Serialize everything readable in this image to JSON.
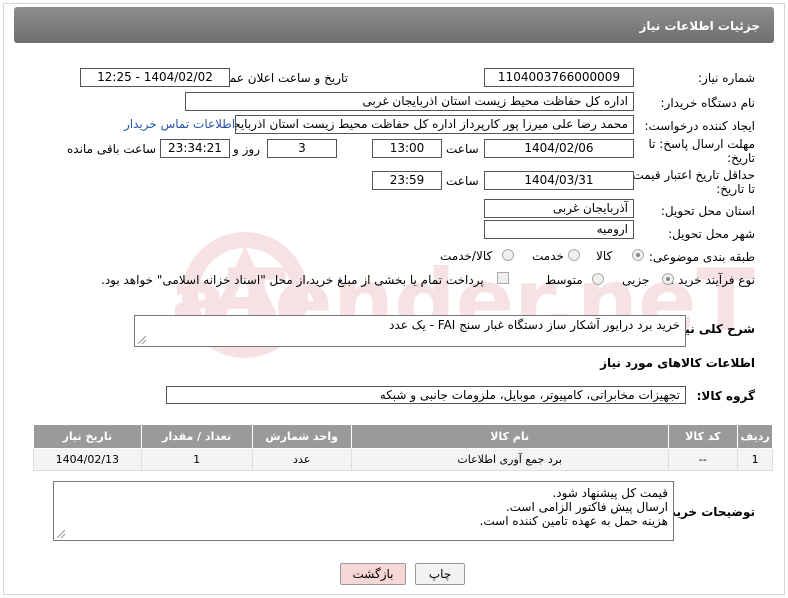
{
  "header": {
    "title": "جزئیات اطلاعات نیاز"
  },
  "fields": {
    "need_number_label": "شماره نیاز:",
    "need_number": "1104003766000009",
    "announce_label": "تاریخ و ساعت اعلان عمومی:",
    "announce_value": "1404/02/02 - 12:25",
    "buyer_org_label": "نام دستگاه خریدار:",
    "buyer_org": "اداره کل حفاظت محیط زیست استان اذربایجان غربی",
    "creator_label": "ایجاد کننده درخواست:",
    "creator": "محمد رضا علی میرزا پور کارپرداز اداره کل حفاظت محیط زیست استان اذربایجان غربی",
    "contact_link": "اطلاعات تماس خریدار",
    "deadline_label_1": "مهلت ارسال پاسخ: تا",
    "deadline_label_2": "تاریخ:",
    "deadline_date": "1404/02/06",
    "time_label": "ساعت",
    "deadline_time": "13:00",
    "days_value": "3",
    "days_label": "روز و",
    "remaining_time": "23:34:21",
    "remaining_label": "ساعت باقی مانده",
    "validity_label_1": "حداقل تاریخ اعتبار قیمت:",
    "validity_label_2": "تا تاریخ:",
    "validity_date": "1404/03/31",
    "validity_time_label": "ساعت",
    "validity_time": "23:59",
    "province_label": "استان محل تحویل:",
    "province": "آذربایجان غربی",
    "city_label": "شهر محل تحویل:",
    "city": "ارومیه",
    "category_label": "طبقه بندی موضوعی:",
    "category_options": [
      "کالا",
      "خدمت",
      "کالا/خدمت"
    ],
    "process_label": "نوع فرآیند خرید :",
    "process_options": [
      "جزیی",
      "متوسط"
    ],
    "payment_note": "پرداخت تمام یا بخشی از مبلغ خرید،از محل \"اسناد خزانه اسلامی\" خواهد بود."
  },
  "description": {
    "label": "شرح کلی نیاز:",
    "text": "خرید برد درایور آشکار ساز دستگاه غبار سنج FAI - یک عدد"
  },
  "goods": {
    "section_title": "اطلاعات کالاهای مورد نیاز",
    "group_label": "گروه کالا:",
    "group_value": "تجهیزات مخابراتی، کامپیوتر، موبایل، ملزومات جانبی و شبکه",
    "columns": [
      "ردیف",
      "کد کالا",
      "نام کالا",
      "واحد شمارش",
      "تعداد / مقدار",
      "تاریخ نیاز"
    ],
    "rows": [
      {
        "row": "1",
        "code": "--",
        "name": "برد جمع آوری اطلاعات",
        "unit": "عدد",
        "qty": "1",
        "date": "1404/02/13"
      }
    ]
  },
  "buyer_notes": {
    "label": "توضیحات خریدار:",
    "lines": [
      "قیمت کل پیشنهاد شود.",
      "ارسال پیش فاکتور الزامی است.",
      "هزینه حمل به عهده تامین کننده است."
    ]
  },
  "buttons": {
    "print": "چاپ",
    "back": "بازگشت"
  },
  "watermark": {
    "text": "AriaTender.neT"
  },
  "colors": {
    "header_bg": "#7d7d7d",
    "table_header_bg": "#9a9a9a",
    "link": "#2a55a8",
    "back_button_bg": "#f7d6d6",
    "watermark": "#c0282d"
  }
}
